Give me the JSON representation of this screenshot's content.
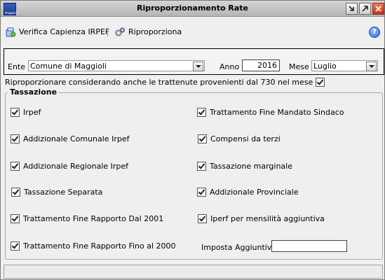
{
  "window": {
    "title": "Riproporzionamento Rate",
    "app_icon_text": "Maggioli",
    "controls": [
      "minimize",
      "restore",
      "close"
    ]
  },
  "toolbar": {
    "verifica_label": "Verifica Capienza IRPEF",
    "riproporziona_label": "Riproporziona"
  },
  "filters": {
    "ente_label": "Ente",
    "ente_value": "Comune di Maggioli",
    "anno_label": "Anno",
    "anno_value": "2016",
    "mese_label": "Mese",
    "mese_value": "Luglio"
  },
  "ripro_option": {
    "label": "Riproporzionare considerando anche le trattenute provenienti dal 730 nel mese",
    "checked": true
  },
  "tassazione": {
    "title": "Tassazione",
    "left": [
      {
        "label": "Irpef",
        "checked": true
      },
      {
        "label": "Addizionale Comunale Irpef",
        "checked": true
      },
      {
        "label": "Addizionale Regionale Irpef",
        "checked": true
      },
      {
        "label": "Tassazione Separata",
        "checked": true
      },
      {
        "label": "Trattamento Fine Rapporto Dal 2001",
        "checked": true
      },
      {
        "label": "Trattamento Fine Rapporto Fino al 2000",
        "checked": true
      }
    ],
    "right": [
      {
        "label": "Trattamento Fine Mandato Sindaco",
        "checked": true
      },
      {
        "label": "Compensi da terzi",
        "checked": true
      },
      {
        "label": "Tassazione marginale",
        "checked": true
      },
      {
        "label": "Addizionale Provinciale",
        "checked": true
      },
      {
        "label": "Iperf per mensilità aggiuntiva",
        "checked": true
      }
    ],
    "imposta_label": "Imposta Aggiuntiva",
    "imposta_value": ""
  },
  "status": {
    "text": ""
  }
}
